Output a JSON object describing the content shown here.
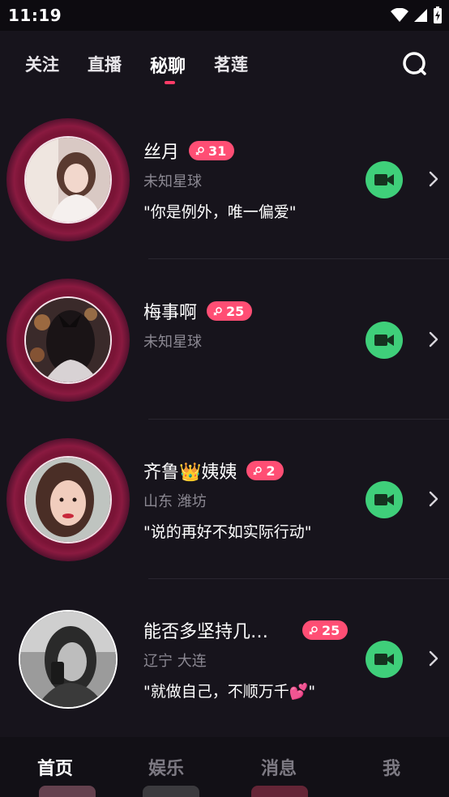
{
  "status_bar": {
    "time": "11:19"
  },
  "top_tabs": [
    {
      "label": "关注",
      "active": false
    },
    {
      "label": "直播",
      "active": false
    },
    {
      "label": "秘聊",
      "active": true
    },
    {
      "label": "茗莲",
      "active": false
    }
  ],
  "colors": {
    "accent": "#ff3b67",
    "badge": "#ff4e74",
    "video_button": "#3fcf7a",
    "background": "#17141c"
  },
  "chats": [
    {
      "name": "丝月",
      "badge": "31",
      "location": "未知星球",
      "bio": "\"你是例外，唯一偏爱\""
    },
    {
      "name": "梅事啊",
      "badge": "25",
      "location": "未知星球",
      "bio": ""
    },
    {
      "name": "齐鲁👑姨姨",
      "badge": "2",
      "location": "山东 潍坊",
      "bio": "\"说的再好不如实际行动\""
    },
    {
      "name": "能否多坚持几…",
      "badge": "25",
      "location": "辽宁 大连",
      "bio": "\"就做自己，不顺万千💕\""
    }
  ],
  "bottom_nav": [
    {
      "label": "首页",
      "active": true
    },
    {
      "label": "娱乐",
      "active": false
    },
    {
      "label": "消息",
      "active": false
    },
    {
      "label": "我",
      "active": false
    }
  ]
}
